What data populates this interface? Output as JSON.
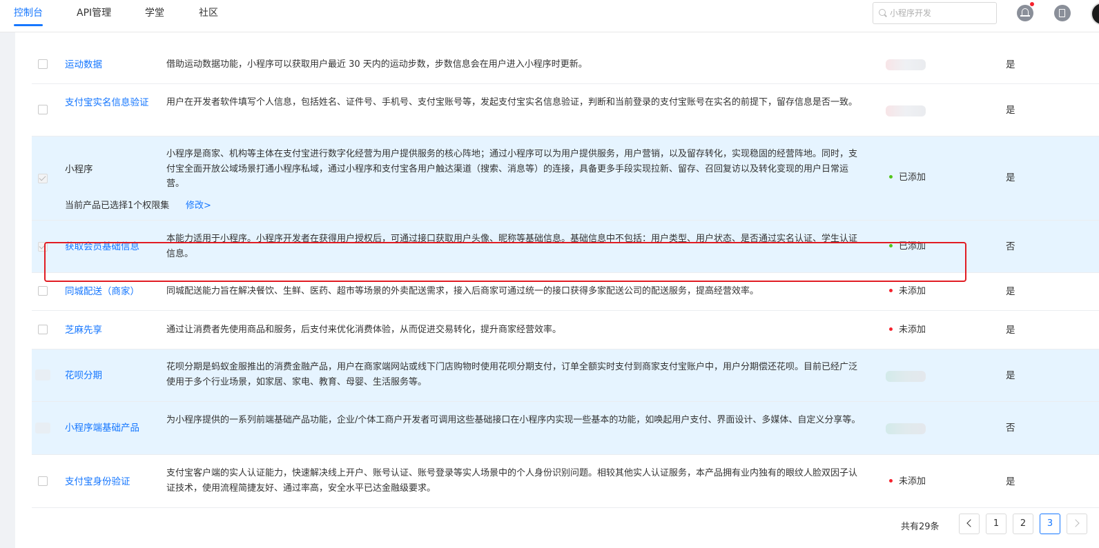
{
  "nav": {
    "tabs": [
      {
        "label": "控制台",
        "active": true
      },
      {
        "label": "API管理"
      },
      {
        "label": "学堂"
      },
      {
        "label": "社区"
      }
    ],
    "search_placeholder": "小程序开发"
  },
  "colors": {
    "accent": "#1677ff",
    "highlight_row": "#e6f4ff",
    "added": "#52c41a",
    "not_added": "#f5222d",
    "frame": "#e11b22"
  },
  "rows": [
    {
      "name": "运动数据",
      "desc": "借助运动数据功能，小程序可以获取用户最近 30 天内的运动步数，步数信息会在用户进入小程序时更新。",
      "status": "",
      "required": "是"
    },
    {
      "name": "支付宝实名信息验证",
      "desc": "用户在开发者软件填写个人信息，包括姓名、证件号、手机号、支付宝账号等，发起支付宝实名信息验证，判断和当前登录的支付宝账号在实名的前提下，留存信息是否一致。",
      "status": "",
      "required": "是"
    },
    {
      "name": "小程序",
      "desc": "小程序是商家、机构等主体在支付宝进行数字化经营为用户提供服务的核心阵地；通过小程序可以为用户提供服务，用户营销，以及留存转化，实现稳固的经营阵地。同时，支付宝全面开放公域场景打通小程序私域，通过小程序和支付宝各用户触达渠道（搜索、消息等）的连接，具备更多手段实现拉新、留存、召回复访以及转化变现的用户日常运营。",
      "status": "已添加",
      "required": "是",
      "sub_text": "当前产品已选择1个权限集",
      "sub_link": "修改>"
    },
    {
      "name": "获取会员基础信息",
      "desc": "本能力适用于小程序。小程序开发者在获得用户授权后，可通过接口获取用户头像、昵称等基础信息。基础信息中不包括：用户类型、用户状态、是否通过实名认证、学生认证信息。",
      "status": "已添加",
      "required": "否"
    },
    {
      "name": "同城配送（商家）",
      "desc": "同城配送能力旨在解决餐饮、生鲜、医药、超市等场景的外卖配送需求，接入后商家可通过统一的接口获得多家配送公司的配送服务，提高经营效率。",
      "status": "未添加",
      "required": "是"
    },
    {
      "name": "芝麻先享",
      "desc": "通过让消费者先使用商品和服务，后支付来优化消费体验，从而促进交易转化，提升商家经营效率。",
      "status": "未添加",
      "required": "是"
    },
    {
      "name": "花呗分期",
      "desc": "花呗分期是蚂蚁金服推出的消费金融产品，用户在商家端网站或线下门店购物时使用花呗分期支付，订单全额实时支付到商家支付宝账户中，用户分期偿还花呗。目前已经广泛使用于多个行业场景，如家居、家电、教育、母婴、生活服务等。",
      "status": "",
      "required": "是"
    },
    {
      "name": "小程序端基础产品",
      "desc": "为小程序提供的一系列前端基础产品功能，企业/个体工商户开发者可调用这些基础接口在小程序内实现一些基本的功能，如唤起用户支付、界面设计、多媒体、自定义分享等。",
      "status": "",
      "required": "否"
    },
    {
      "name": "支付宝身份验证",
      "desc": "支付宝客户端的实人认证能力，快速解决线上开户、账号认证、账号登录等实人场景中的个人身份识别问题。相较其他实人认证服务，本产品拥有业内独有的眼纹人脸双因子认证技术，使用流程简捷友好、通过率高，安全水平已达金融级要求。",
      "status": "未添加",
      "required": "是"
    }
  ],
  "pagination": {
    "total_text": "共有29条",
    "pages": [
      "1",
      "2",
      "3"
    ],
    "current": "3"
  }
}
